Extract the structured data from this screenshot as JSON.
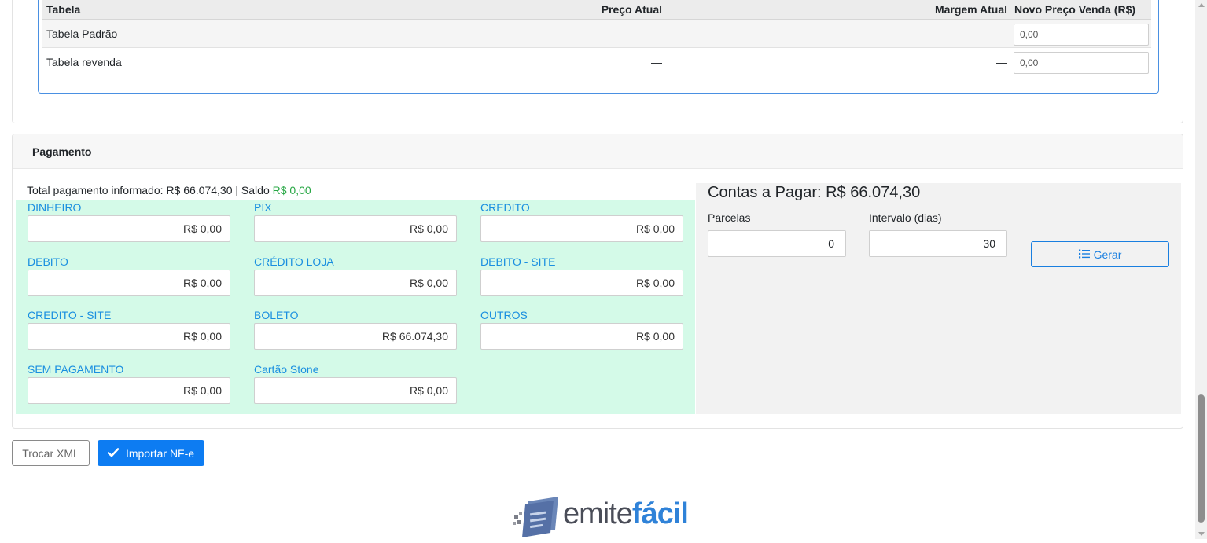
{
  "price_table": {
    "headers": {
      "tabela": "Tabela",
      "preco_atual": "Preço Atual",
      "margem_atual": "Margem Atual",
      "novo_preco": "Novo Preço Venda (R$)"
    },
    "rows": [
      {
        "tabela": "Tabela Padrão",
        "preco_atual": "—",
        "margem_atual": "—",
        "novo_preco": "0,00"
      },
      {
        "tabela": "Tabela revenda",
        "preco_atual": "—",
        "margem_atual": "—",
        "novo_preco": "0,00"
      }
    ]
  },
  "pagamento": {
    "title": "Pagamento",
    "summary_prefix": "Total pagamento informado: R$ 66.074,30 | Saldo ",
    "saldo": "R$ 0,00",
    "saldo_color": "#28a745",
    "methods": [
      {
        "label": "DINHEIRO",
        "value": "R$ 0,00"
      },
      {
        "label": "PIX",
        "value": "R$ 0,00"
      },
      {
        "label": "CREDITO",
        "value": "R$ 0,00"
      },
      {
        "label": "DEBITO",
        "value": "R$ 0,00"
      },
      {
        "label": "CRÉDITO LOJA",
        "value": "R$ 0,00"
      },
      {
        "label": "DEBITO - SITE",
        "value": "R$ 0,00"
      },
      {
        "label": "CREDITO - SITE",
        "value": "R$ 0,00"
      },
      {
        "label": "BOLETO",
        "value": "R$ 66.074,30"
      },
      {
        "label": "OUTROS",
        "value": "R$ 0,00"
      },
      {
        "label": "SEM PAGAMENTO",
        "value": "R$ 0,00"
      },
      {
        "label": "Cartão Stone",
        "value": "R$ 0,00"
      }
    ],
    "methods_bg": "#d4fae8",
    "label_color": "#1a8fe0"
  },
  "contas": {
    "title": "Contas a Pagar: R$ 66.074,30",
    "parcelas_label": "Parcelas",
    "parcelas_value": "0",
    "intervalo_label": "Intervalo (dias)",
    "intervalo_value": "30",
    "gerar_label": "Gerar",
    "gerar_icon": "list-icon"
  },
  "actions": {
    "trocar_label": "Trocar XML",
    "importar_label": "Importar NF-e",
    "importar_icon": "check-icon",
    "primary_color": "#0d7cf2"
  },
  "logo": {
    "part1": "emite",
    "part2": "fácil"
  }
}
